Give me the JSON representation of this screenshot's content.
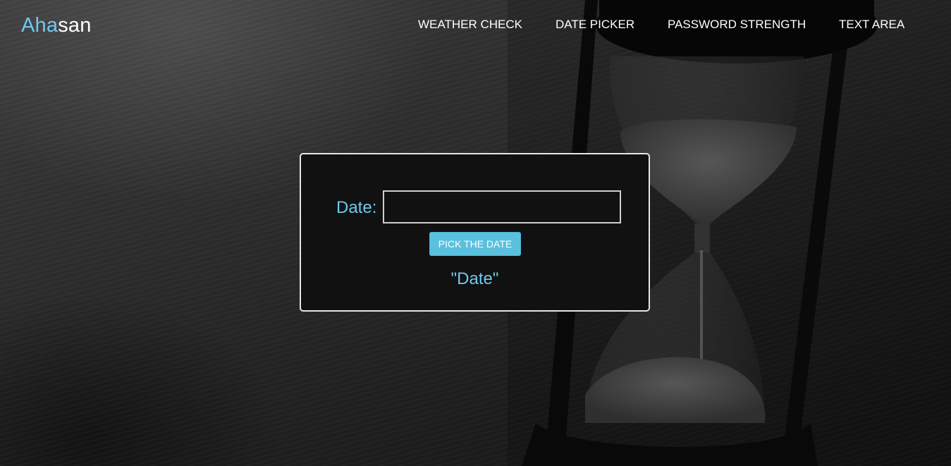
{
  "brand": {
    "part1": "Aha",
    "part2": "san"
  },
  "nav": {
    "items": [
      {
        "label": "WEATHER CHECK"
      },
      {
        "label": "DATE PICKER"
      },
      {
        "label": "PASSWORD STRENGTH"
      },
      {
        "label": "TEXT AREA"
      }
    ]
  },
  "form": {
    "date_label": "Date:",
    "date_value": "",
    "pick_button_label": "PICK THE DATE",
    "result_text": "\"Date\""
  },
  "colors": {
    "accent": "#6fc9ef",
    "button": "#5bc0de",
    "card_bg": "#111111"
  },
  "background": {
    "icon": "hourglass-photo"
  }
}
